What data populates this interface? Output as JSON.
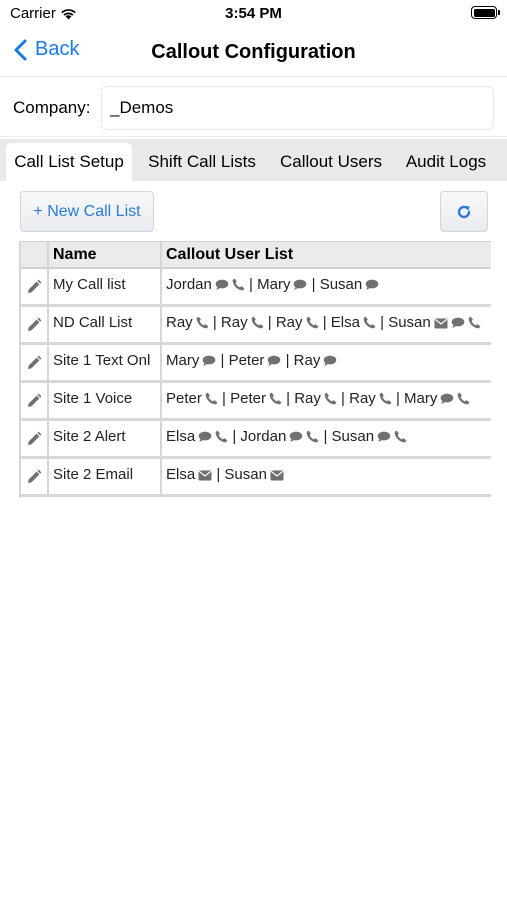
{
  "status_bar": {
    "carrier": "Carrier",
    "time": "3:54 PM"
  },
  "nav": {
    "back_label": "Back",
    "title": "Callout Configuration"
  },
  "company": {
    "label": "Company:",
    "value": "_Demos"
  },
  "tabs": [
    {
      "label": "Call List Setup",
      "active": true
    },
    {
      "label": "Shift Call Lists",
      "active": false
    },
    {
      "label": "Callout Users",
      "active": false
    },
    {
      "label": "Audit Logs",
      "active": false
    }
  ],
  "toolbar": {
    "new_label": "+ New Call List",
    "refresh_icon": "refresh-icon"
  },
  "table": {
    "headers": {
      "name": "Name",
      "users": "Callout User List"
    },
    "rows": [
      {
        "name": "My Call list",
        "users": [
          {
            "name": "Jordan",
            "icons": [
              "chat",
              "phone"
            ]
          },
          {
            "name": "Mary",
            "icons": [
              "chat"
            ]
          },
          {
            "name": "Susan",
            "icons": [
              "chat"
            ]
          }
        ]
      },
      {
        "name": "ND Call List",
        "users": [
          {
            "name": "Ray",
            "icons": [
              "phone"
            ]
          },
          {
            "name": "Ray",
            "icons": [
              "phone"
            ]
          },
          {
            "name": "Ray",
            "icons": [
              "phone"
            ]
          },
          {
            "name": "Elsa",
            "icons": [
              "phone"
            ]
          },
          {
            "name": "Susan",
            "icons": [
              "email",
              "chat",
              "phone"
            ]
          }
        ]
      },
      {
        "name": "Site 1 Text Onl",
        "users": [
          {
            "name": "Mary",
            "icons": [
              "chat"
            ]
          },
          {
            "name": "Peter",
            "icons": [
              "chat"
            ]
          },
          {
            "name": "Ray",
            "icons": [
              "chat"
            ]
          }
        ]
      },
      {
        "name": "Site 1 Voice",
        "users": [
          {
            "name": "Peter",
            "icons": [
              "phone"
            ]
          },
          {
            "name": "Peter",
            "icons": [
              "phone"
            ]
          },
          {
            "name": "Ray",
            "icons": [
              "phone"
            ]
          },
          {
            "name": "Ray",
            "icons": [
              "phone"
            ]
          },
          {
            "name": "Mary",
            "icons": [
              "chat",
              "phone"
            ]
          }
        ]
      },
      {
        "name": "Site 2 Alert",
        "users": [
          {
            "name": "Elsa",
            "icons": [
              "chat",
              "phone"
            ]
          },
          {
            "name": "Jordan",
            "icons": [
              "chat",
              "phone"
            ]
          },
          {
            "name": "Susan",
            "icons": [
              "chat",
              "phone"
            ]
          }
        ]
      },
      {
        "name": "Site 2 Email",
        "users": [
          {
            "name": "Elsa",
            "icons": [
              "email"
            ]
          },
          {
            "name": "Susan",
            "icons": [
              "email"
            ]
          }
        ]
      }
    ]
  },
  "colors": {
    "accent": "#1a7ae6",
    "icon_gray": "#707070",
    "tab_bar": "#e9e9e9"
  }
}
